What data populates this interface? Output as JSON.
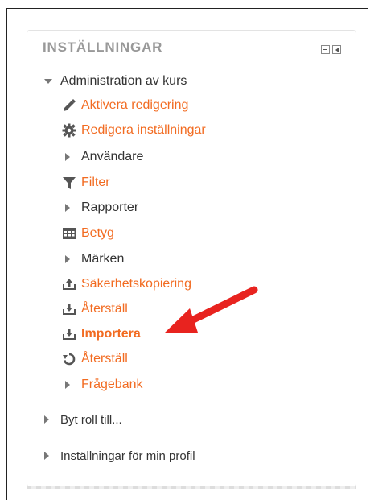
{
  "block": {
    "title": "INSTÄLLNINGAR"
  },
  "admin": {
    "label": "Administration av kurs",
    "items": [
      {
        "label": "Aktivera redigering"
      },
      {
        "label": "Redigera inställningar"
      },
      {
        "label": "Användare"
      },
      {
        "label": "Filter"
      },
      {
        "label": "Rapporter"
      },
      {
        "label": "Betyg"
      },
      {
        "label": "Märken"
      },
      {
        "label": "Säkerhetskopiering"
      },
      {
        "label": "Återställ"
      },
      {
        "label": "Importera"
      },
      {
        "label": "Återställ"
      },
      {
        "label": "Frågebank"
      }
    ]
  },
  "switch_role": {
    "label": "Byt roll till..."
  },
  "profile_settings": {
    "label": "Inställningar för min profil"
  },
  "colors": {
    "link": "#f26b21",
    "text": "#333333",
    "title": "#999999",
    "annotation_arrow": "#e8231f"
  }
}
